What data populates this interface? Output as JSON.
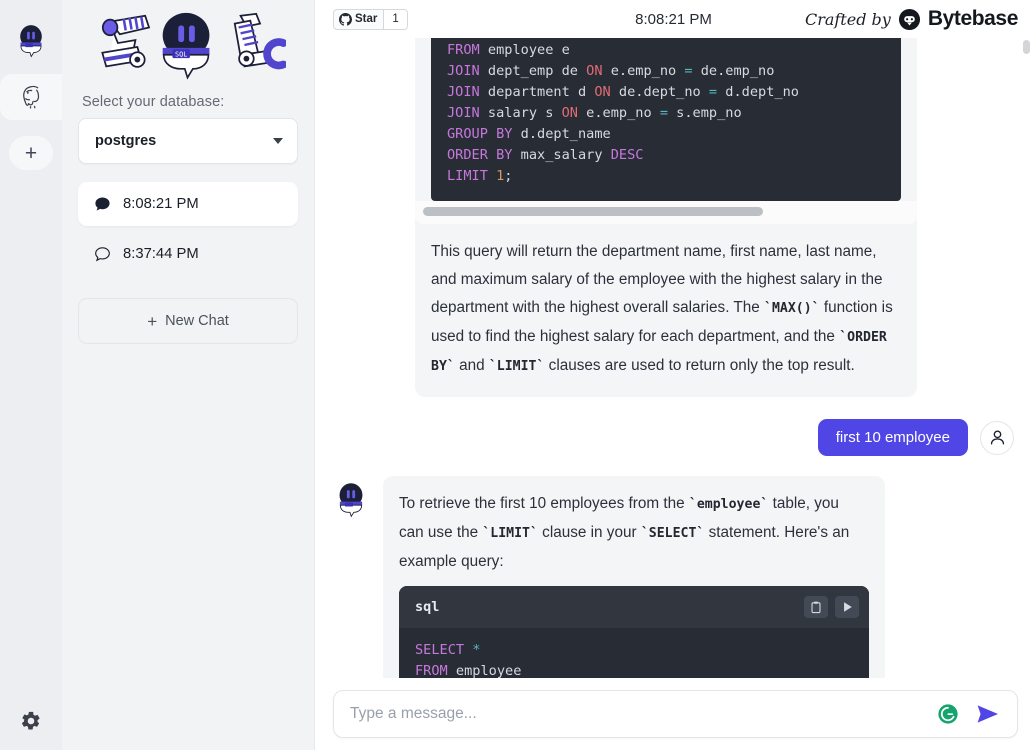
{
  "rail": {
    "items": [
      {
        "name": "sql-chat-logo",
        "label": "SQL Chat"
      },
      {
        "name": "postgres-db",
        "label": "PostgreSQL",
        "active": true
      },
      {
        "name": "add-connection",
        "label": "+"
      }
    ],
    "settings_label": "Settings"
  },
  "sidebar": {
    "logo_alt": "SQL Chat",
    "db_label": "Select your database:",
    "db_selected": "postgres",
    "chats": [
      {
        "time": "8:08:21 PM",
        "active": true,
        "icon": "chat-bubble-filled-icon"
      },
      {
        "time": "8:37:44 PM",
        "active": false,
        "icon": "chat-bubble-outline-icon"
      }
    ],
    "new_chat": "New Chat",
    "new_chat_plus": "+"
  },
  "topbar": {
    "github_star_label": "Star",
    "github_star_count": "1",
    "session_time": "8:08:21 PM",
    "crafted_by": "Crafted by",
    "brand": "Bytebase"
  },
  "conversation": [
    {
      "role": "assistant",
      "code_top": {
        "lines": [
          "FROM employee e",
          "JOIN dept_emp de ON e.emp_no = de.emp_no",
          "JOIN department d ON de.dept_no = d.dept_no",
          "JOIN salary s ON e.emp_no = s.emp_no",
          "GROUP BY d.dept_name",
          "ORDER BY max_salary DESC",
          "LIMIT 1;"
        ]
      },
      "text": "This query will return the department name, first name, last name, and maximum salary of the employee with the highest salary in the department with the highest overall salaries. The `MAX()` function is used to find the highest salary for each department, and the `ORDER BY` and `LIMIT` clauses are used to return only the top result."
    },
    {
      "role": "user",
      "text": "first 10 employee"
    },
    {
      "role": "assistant",
      "text": "To retrieve the first 10 employees from the `employee` table, you can use the `LIMIT` clause in your `SELECT` statement. Here's an example query:",
      "code": {
        "lang": "sql",
        "copy_icon": "clipboard-icon",
        "run_icon": "play-icon",
        "lines": [
          "SELECT *",
          "FROM employee"
        ]
      }
    }
  ],
  "composer": {
    "placeholder": "Type a message...",
    "value": "",
    "grammarly_icon": "grammarly-icon",
    "send_icon": "send-icon"
  },
  "colors": {
    "accent": "#4f46e5",
    "sidebar_bg": "#f2f3f5",
    "rail_bg": "#eceef1",
    "bot_bubble": "#f4f5f7",
    "code_bg": "#282c34",
    "code_head": "#31363f"
  }
}
